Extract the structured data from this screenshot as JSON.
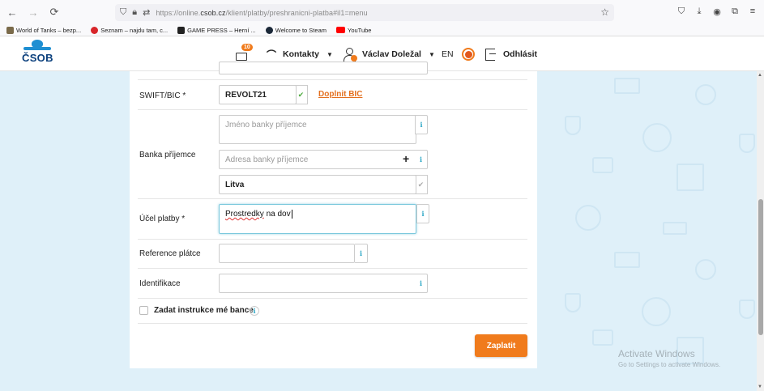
{
  "browser": {
    "url_prefix": "https://online.",
    "url_domain": "csob.cz",
    "url_path": "/klient/platby/preshranicni-platba#il1=menu",
    "bookmarks": [
      {
        "label": "World of Tanks – bezp...",
        "color": "#7a6a4a"
      },
      {
        "label": "Seznam – najdu tam, c...",
        "color": "#d8262a"
      },
      {
        "label": "GAME PRESS – Herní ...",
        "color": "#222222"
      },
      {
        "label": "Welcome to Steam",
        "color": "#1b2838"
      },
      {
        "label": "YouTube",
        "color": "#ff0000"
      }
    ]
  },
  "header": {
    "logo_text": "ČSOB",
    "mail_badge": "10",
    "contacts_label": "Kontakty",
    "user_name": "Václav Doležal",
    "lang": "EN",
    "logout_label": "Odhlásit"
  },
  "form": {
    "swift_label": "SWIFT/BIC *",
    "swift_value": "REVOLT21",
    "swift_link": "Doplnit BIC",
    "bank_label": "Banka příjemce",
    "bank_name_placeholder": "Jméno banky příjemce",
    "bank_address_placeholder": "Adresa banky příjemce",
    "bank_country": "Litva",
    "purpose_label": "Účel platby *",
    "purpose_word1": "Prostredky",
    "purpose_rest": " na dov",
    "reference_label": "Reference plátce",
    "identification_label": "Identifikace",
    "instructions_label": "Zadat instrukce mé bance",
    "pay_button": "Zaplatit",
    "info_glyph": "i"
  },
  "watermark": {
    "title": "Activate Windows",
    "subtitle": "Go to Settings to activate Windows."
  },
  "colors": {
    "accent": "#f07b1c",
    "info": "#2aa6c5",
    "page_bg": "#dff0f9"
  }
}
